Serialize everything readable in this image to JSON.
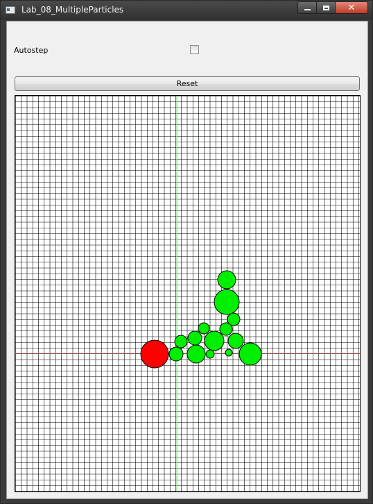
{
  "window": {
    "title": "Lab_08_MultipleParticles",
    "close_glyph": "✕"
  },
  "controls": {
    "autostep_label": "Autostep",
    "autostep_checked": false,
    "reset_label": "Reset"
  },
  "simulation": {
    "grid_color": "#000000",
    "x_axis_color": "#ff9090",
    "y_axis_color": "#7be37b",
    "primary_particle_color": "#ff0000",
    "particle_color": "#00ee00",
    "particle_stroke": "#000000"
  }
}
